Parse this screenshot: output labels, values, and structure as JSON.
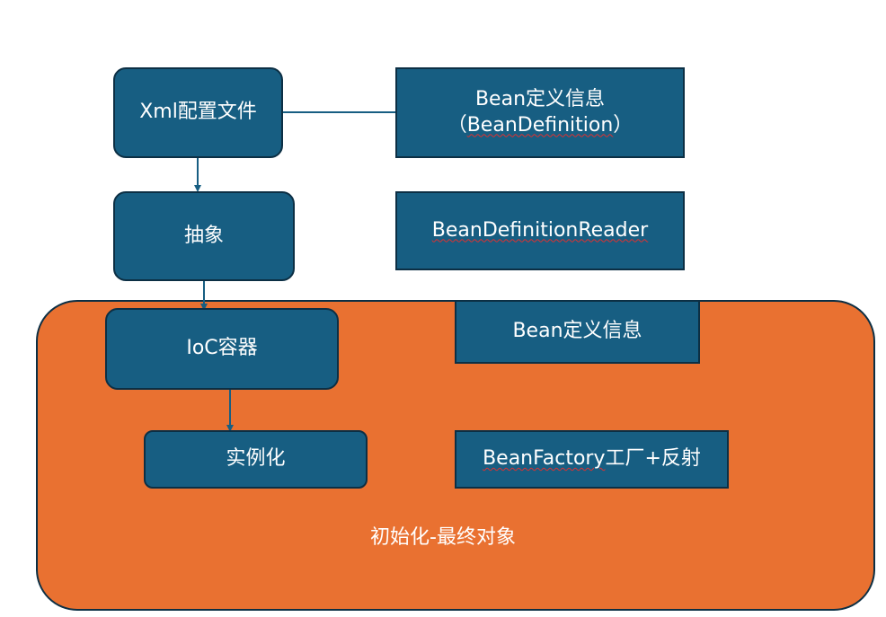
{
  "diagram": {
    "nodes": {
      "xml_config": "Xml配置文件",
      "abstraction": "抽象",
      "ioc_container": "IoC容器",
      "instantiation": "实例化",
      "bean_definition_title": "Bean定义信息",
      "bean_definition_sub_prefix": "（",
      "bean_definition_sub_word": "BeanDefinition",
      "bean_definition_sub_suffix": "）",
      "bean_definition_reader": "BeanDefinitionReader",
      "bean_definition_info": "Bean定义信息",
      "bean_factory_word": "BeanFactory",
      "bean_factory_rest": "工厂+反射"
    },
    "region_label": "初始化-最终对象"
  },
  "colors": {
    "node_fill": "#175e82",
    "node_border": "#0c2f44",
    "region_fill": "#e97131",
    "text": "#ffffff",
    "connector": "#175e82"
  }
}
